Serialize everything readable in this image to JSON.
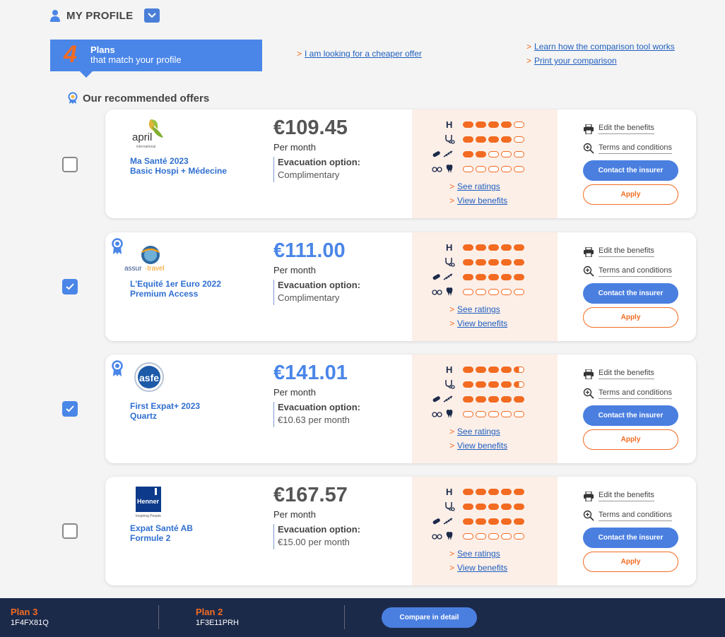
{
  "header": {
    "title": "MY PROFILE",
    "plans_count": "4",
    "plans_label": "Plans",
    "plans_sub": "that match your profile",
    "cheaper_link": "I am looking for a cheaper offer",
    "learn_link": "Learn how the comparison tool works",
    "print_link": "Print your comparison",
    "recommended": "Our recommended offers"
  },
  "colors": {
    "accent": "#4a86e8",
    "orange": "#f26b21",
    "footer": "#1c2a4a",
    "ratings_bg": "#fcefe8"
  },
  "rating_icons": [
    "hospital-icon",
    "stethoscope-icon",
    "pills-syringe-icon",
    "glasses-tooth-icon"
  ],
  "cards": [
    {
      "checked": false,
      "recommended": false,
      "logo": "april",
      "logo_text": "april",
      "logo_sub": "international",
      "name_line1": "Ma Santé 2023",
      "name_line2": "Basic Hospi + Médecine",
      "price": "€109.45",
      "price_blue": false,
      "per_month": "Per month",
      "evac_label": "Evacuation option:",
      "evac_value": "Complimentary",
      "ratings": [
        4,
        4,
        2,
        0
      ],
      "see_ratings": "See ratings",
      "view_benefits": "View benefits",
      "edit": "Edit the benefits",
      "terms": "Terms and conditions",
      "contact": "Contact the insurer",
      "apply": "Apply"
    },
    {
      "checked": true,
      "recommended": true,
      "logo": "assur-travel",
      "logo_text": "assur-travel",
      "logo_sub": "",
      "name_line1": "L'Equité 1er Euro 2022",
      "name_line2": "Premium Access",
      "price": "€111.00",
      "price_blue": true,
      "per_month": "Per month",
      "evac_label": "Evacuation option:",
      "evac_value": "Complimentary",
      "ratings": [
        5,
        5,
        5,
        0
      ],
      "see_ratings": "See ratings",
      "view_benefits": "View benefits",
      "edit": "Edit the benefits",
      "terms": "Terms and conditions",
      "contact": "Contact the insurer",
      "apply": "Apply"
    },
    {
      "checked": true,
      "recommended": true,
      "logo": "asfe",
      "logo_text": "asfe",
      "logo_sub": "",
      "name_line1": "First Expat+ 2023",
      "name_line2": "Quartz",
      "price": "€141.01",
      "price_blue": true,
      "per_month": "Per month",
      "evac_label": "Evacuation option:",
      "evac_value": "€10.63 per month",
      "ratings": [
        4.5,
        4.5,
        5,
        0
      ],
      "see_ratings": "See ratings",
      "view_benefits": "View benefits",
      "edit": "Edit the benefits",
      "terms": "Terms and conditions",
      "contact": "Contact the insurer",
      "apply": "Apply"
    },
    {
      "checked": false,
      "recommended": false,
      "logo": "henner",
      "logo_text": "Henner",
      "logo_sub": "Inspiring People",
      "name_line1": "Expat Santé AB",
      "name_line2": "Formule 2",
      "price": "€167.57",
      "price_blue": false,
      "per_month": "Per month",
      "evac_label": "Evacuation option:",
      "evac_value": "€15.00 per month",
      "ratings": [
        5,
        5,
        5,
        0
      ],
      "see_ratings": "See ratings",
      "view_benefits": "View benefits",
      "edit": "Edit the benefits",
      "terms": "Terms and conditions",
      "contact": "Contact the insurer",
      "apply": "Apply"
    }
  ],
  "footer": {
    "plan_a_label": "Plan 3",
    "plan_a_code": "1F4FX81Q",
    "plan_b_label": "Plan 2",
    "plan_b_code": "1F3E11PRH",
    "compare": "Compare in detail"
  }
}
